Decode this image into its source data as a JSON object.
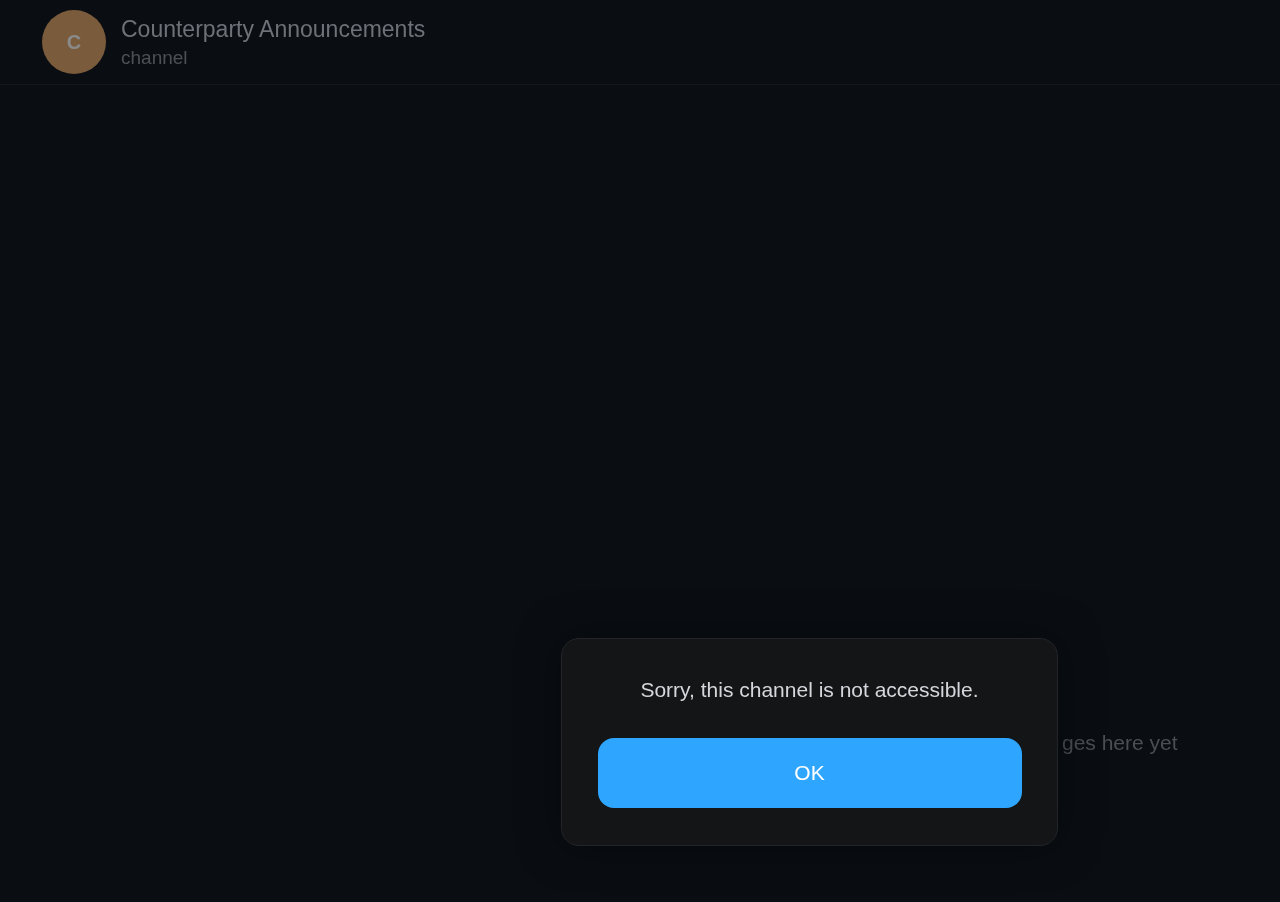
{
  "header": {
    "avatar_letter": "C",
    "title": "Counterparty Announcements",
    "subtitle": "channel"
  },
  "empty_state": {
    "text": "ges here yet"
  },
  "dialog": {
    "message": "Sorry, this channel is not accessible.",
    "button": "OK"
  }
}
